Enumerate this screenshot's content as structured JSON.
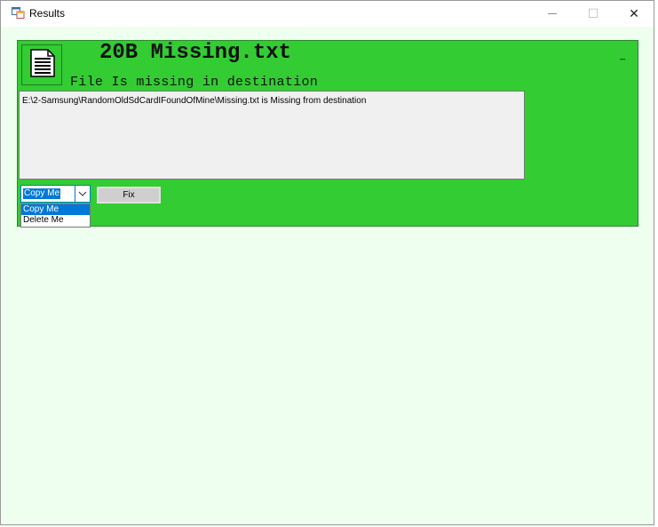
{
  "window": {
    "title": "Results",
    "minimize_glyph": "—",
    "maximize_glyph": "☐",
    "close_glyph": "✕",
    "app_icon": "app-form-icon"
  },
  "result": {
    "heading": "20B Missing.txt",
    "subheading": "File Is missing in destination",
    "message": "E:\\2-Samsung\\RandomOldSdCardIFoundOfMine\\Missing.txt is Missing from destination",
    "panel_minimize": "_",
    "panel_color": "#33cc33",
    "file_icon": "document-icon"
  },
  "action_select": {
    "selected": "Copy Me",
    "options": [
      "Copy Me",
      "Delete Me"
    ]
  },
  "fix_button": {
    "label": "Fix"
  }
}
